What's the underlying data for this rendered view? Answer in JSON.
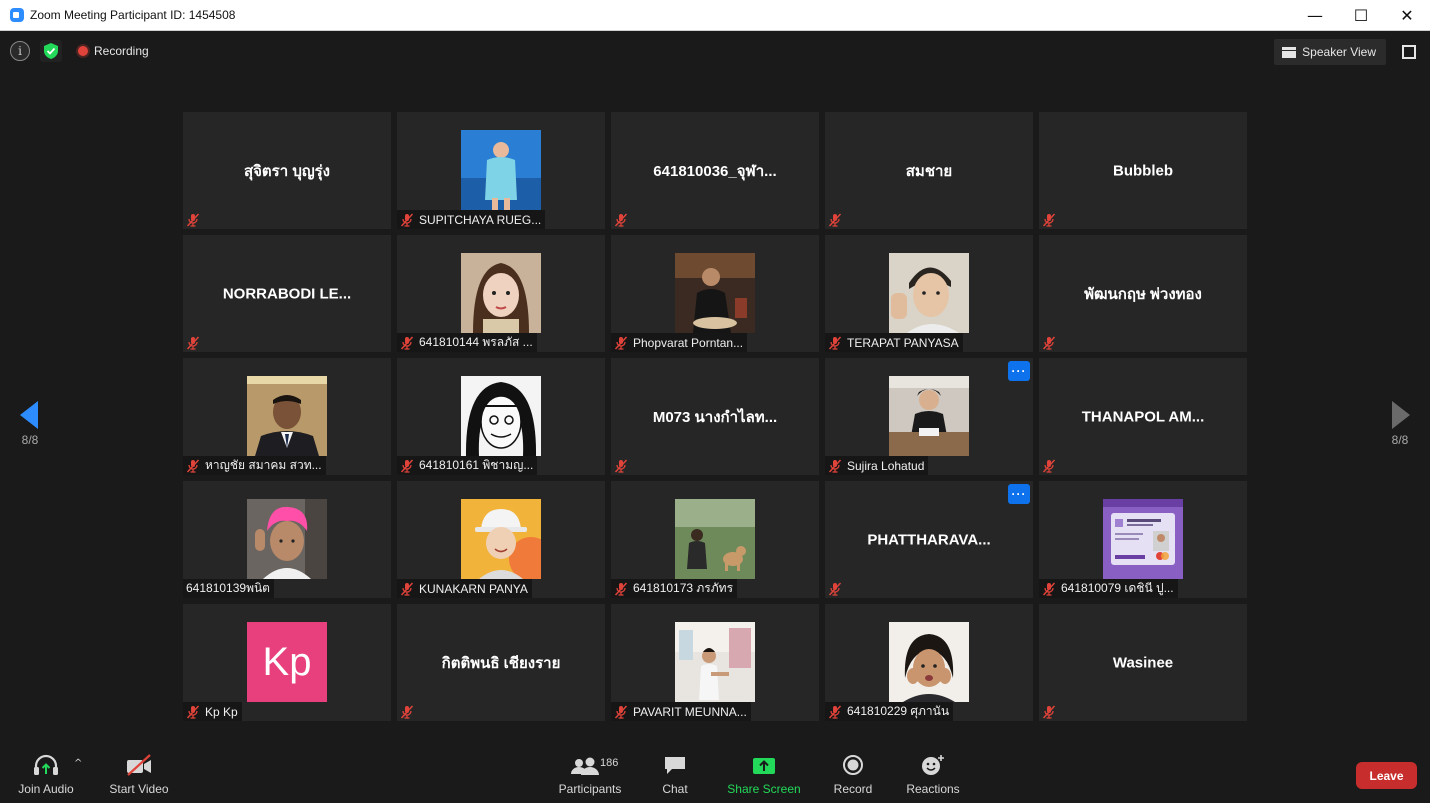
{
  "window": {
    "title": "Zoom Meeting Participant ID: 1454508",
    "minimize": "—",
    "maximize": "☐",
    "close": "✕"
  },
  "topbar": {
    "recording_label": "Recording",
    "speaker_view_label": "Speaker View",
    "info_icon": "info-icon",
    "security_icon": "shield-icon"
  },
  "gallery": {
    "tiles": [
      {
        "name": "สุจิตรา บุญรุ่ง",
        "type": "name",
        "label": "",
        "muted": true
      },
      {
        "name": "",
        "type": "photo",
        "label": "SUPITCHAYA RUEG...",
        "muted": true,
        "photo": "person-blue-dress"
      },
      {
        "name": "641810036_จุฬา...",
        "type": "name",
        "label": "",
        "muted": true
      },
      {
        "name": "สมชาย",
        "type": "name",
        "label": "",
        "muted": true
      },
      {
        "name": "Bubbleb",
        "type": "name",
        "label": "",
        "muted": true
      },
      {
        "name": "NORRABODI LE...",
        "type": "name",
        "label": "",
        "muted": true
      },
      {
        "name": "",
        "type": "photo",
        "label": "641810144 พรลภัส ...",
        "muted": true,
        "photo": "selfie-girl"
      },
      {
        "name": "",
        "type": "photo",
        "label": "Phopvarat Porntan...",
        "muted": true,
        "photo": "person-eating"
      },
      {
        "name": "",
        "type": "photo",
        "label": "TERAPAT PANYASA",
        "muted": true,
        "photo": "young-man"
      },
      {
        "name": "พัฒนกฤษ พ่วงทอง",
        "type": "name",
        "label": "",
        "muted": true
      },
      {
        "name": "",
        "type": "photo",
        "label": "หาญชัย สมาคม สวท...",
        "muted": true,
        "photo": "man-suit"
      },
      {
        "name": "",
        "type": "photo",
        "label": "641810161 พิชามญ...",
        "muted": true,
        "photo": "manga-drawing"
      },
      {
        "name": "M073 นางกำไลท...",
        "type": "name",
        "label": "",
        "muted": true
      },
      {
        "name": "",
        "type": "photo",
        "label": "Sujira Lohatud",
        "muted": true,
        "photo": "woman-desk",
        "more": "···"
      },
      {
        "name": "THANAPOL AM...",
        "type": "name",
        "label": "",
        "muted": true
      },
      {
        "name": "",
        "type": "photo",
        "label": "641810139พนิต",
        "muted": false,
        "photo": "pink-hair"
      },
      {
        "name": "",
        "type": "photo",
        "label": "KUNAKARN PANYA",
        "muted": true,
        "photo": "bucket-hat"
      },
      {
        "name": "",
        "type": "photo",
        "label": "641810173 ภรภัทร",
        "muted": true,
        "photo": "person-with-dog"
      },
      {
        "name": "PHATTHARAVA...",
        "type": "name",
        "label": "",
        "muted": true,
        "more": "···"
      },
      {
        "name": "",
        "type": "photo",
        "label": "641810079 เดชินี ปู...",
        "muted": true,
        "photo": "id-card"
      },
      {
        "name": "",
        "type": "initials",
        "initials": "Kp",
        "label": "Kp Kp",
        "muted": true
      },
      {
        "name": "กิตติพนธิ เชียงราย",
        "type": "name",
        "label": "",
        "muted": true
      },
      {
        "name": "",
        "type": "photo",
        "label": "PAVARIT MEUNNA...",
        "muted": true,
        "photo": "person-street"
      },
      {
        "name": "",
        "type": "photo",
        "label": "641810229 ศุภานัน",
        "muted": true,
        "photo": "smiling-girl"
      },
      {
        "name": "Wasinee",
        "type": "name",
        "label": "",
        "muted": true
      }
    ]
  },
  "navigation": {
    "page_left": "8/8",
    "page_right": "8/8"
  },
  "toolbar": {
    "join_audio": "Join Audio",
    "start_video": "Start Video",
    "participants": "Participants",
    "participants_count": "186",
    "chat": "Chat",
    "share_screen": "Share Screen",
    "record": "Record",
    "reactions": "Reactions",
    "leave": "Leave",
    "caret": "^"
  },
  "colors": {
    "background": "#1a1a1a",
    "tile": "#262626",
    "accent_blue": "#0e72ed",
    "share_green": "#23d959",
    "leave_red": "#c72d2d",
    "mute_red": "#e0433a"
  }
}
